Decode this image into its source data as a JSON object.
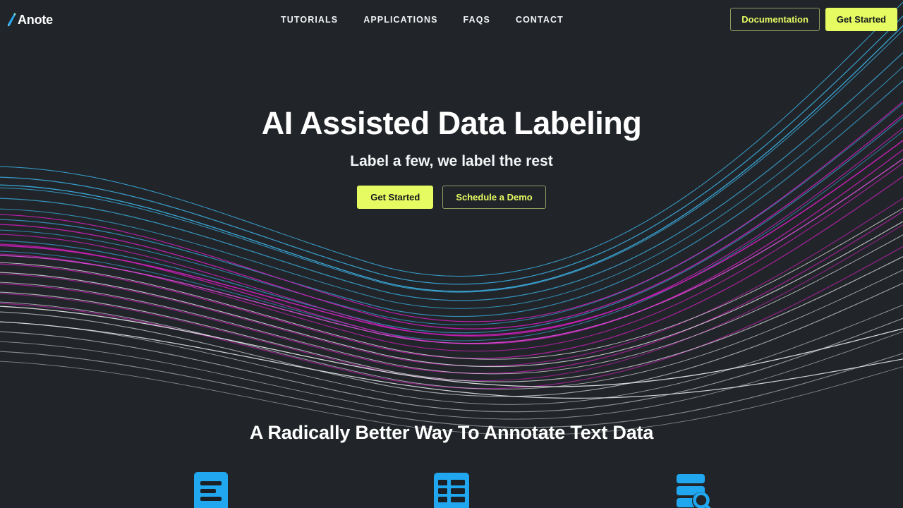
{
  "theme": {
    "background": "#212529",
    "accent": "#e6fb62",
    "icon_blue": "#21a7f0",
    "logo_blue": "#2aa8ef",
    "text": "#ffffff",
    "wave_cyan": "#3aa7d8",
    "wave_magenta": "#c61fb4",
    "wave_white": "#dfe2e4"
  },
  "navbar": {
    "brand": {
      "name": "Anote",
      "icon": "pencil-slash-icon"
    },
    "links": [
      {
        "label": "TUTORIALS",
        "name": "tutorials"
      },
      {
        "label": "APPLICATIONS",
        "name": "applications"
      },
      {
        "label": "FAQS",
        "name": "faqs"
      },
      {
        "label": "CONTACT",
        "name": "contact"
      }
    ],
    "actions": {
      "documentation_label": "Documentation",
      "get_started_label": "Get Started"
    }
  },
  "hero": {
    "title": "AI Assisted Data Labeling",
    "subtitle": "Label a few, we label the rest",
    "primary_cta": "Get Started",
    "secondary_cta": "Schedule a Demo"
  },
  "features": {
    "title": "A Radically Better Way To Annotate Text Data",
    "cards": [
      {
        "icon": "document-lines-icon",
        "name": "feature-card-document"
      },
      {
        "icon": "table-grid-icon",
        "name": "feature-card-table"
      },
      {
        "icon": "database-search-icon",
        "name": "feature-card-database"
      }
    ]
  }
}
